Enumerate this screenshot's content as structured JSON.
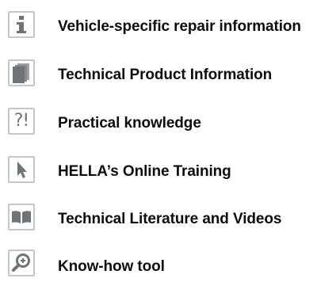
{
  "menu": {
    "items": [
      {
        "label": "Vehicle-specific repair information",
        "icon": "info-icon"
      },
      {
        "label": "Technical Product Information",
        "icon": "document-icon"
      },
      {
        "label": "Practical knowledge",
        "icon": "question-exclamation-icon",
        "glyph": "?!"
      },
      {
        "label": "HELLA’s Online Training",
        "icon": "cursor-icon"
      },
      {
        "label": "Technical Literature and Videos",
        "icon": "book-icon"
      },
      {
        "label": "Know-how tool",
        "icon": "magnifier-icon"
      }
    ]
  },
  "colors": {
    "icon_border": "#c4c7ca",
    "icon_fill": "#6f7478",
    "text": "#0d0d0d"
  }
}
